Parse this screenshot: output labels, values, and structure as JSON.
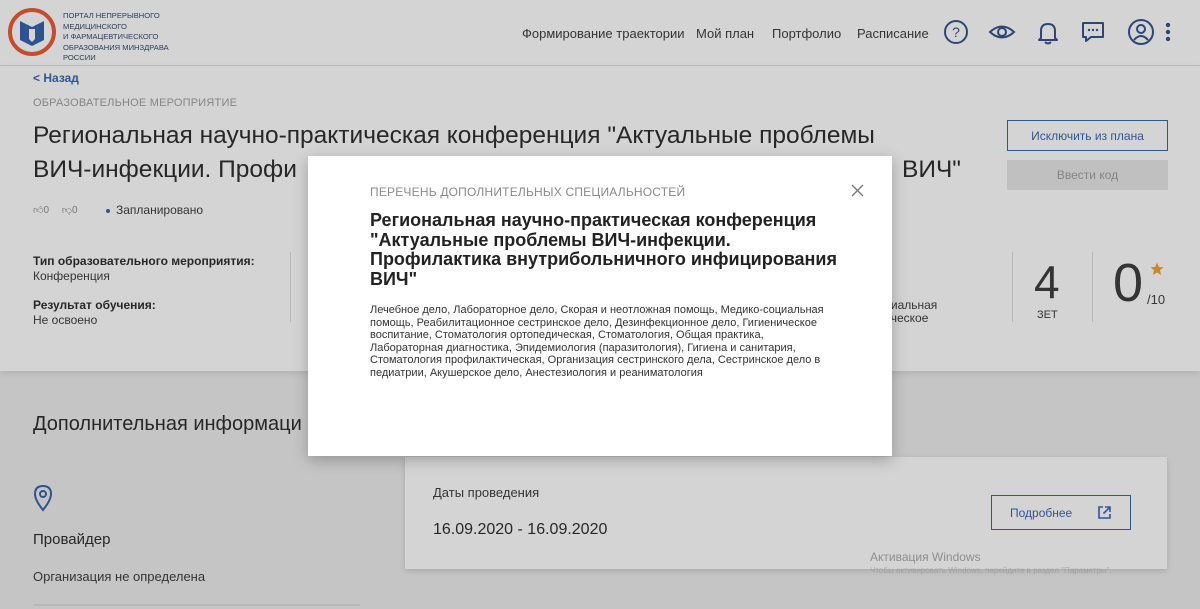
{
  "header": {
    "logo_lines": [
      "Портал непрерывного",
      "медицинского",
      "и фармацевтического",
      "образования минздрава России"
    ],
    "nav": [
      "Формирование траектории",
      "Мой план",
      "Портфолио",
      "Расписание"
    ]
  },
  "page": {
    "back": "< Назад",
    "kind": "Образовательное мероприятие",
    "title_line1": "Региональная научно-практическая конференция \"Актуальные проблемы",
    "title_line2_left": "ВИЧ-инфекции. Профи",
    "title_line2_right": "ВИЧ\"",
    "likes": "0",
    "dislikes": "0",
    "status": "Запланировано"
  },
  "actions": {
    "exclude": "Исключить из плана",
    "enter_code": "Ввести код"
  },
  "info": {
    "type_label": "Тип образовательного мероприятия:",
    "type_value": "Конференция",
    "result_label": "Результат обучения:",
    "result_value": "Не освоено",
    "partial_line1": "циальная",
    "partial_line2": "ическое"
  },
  "stats": {
    "zet": "4",
    "zet_label": "ЗЕТ",
    "score": "0",
    "score_max": "/10",
    "accent_color": "#f0a020"
  },
  "extra": {
    "title": "Дополнительная информаци",
    "provider_label": "Провайдер",
    "provider_value": "Организация не определена",
    "dates_label": "Даты проведения",
    "dates_value": "16.09.2020 - 16.09.2020",
    "more": "Подробнее"
  },
  "watermark": {
    "line1": "Активация Windows",
    "line2": "Чтобы активировать Windows, перейдите в раздел \"Параметры\"."
  },
  "modal": {
    "kind": "Перечень дополнительных специальностей",
    "title": "Региональная научно-практическая конференция \"Актуальные проблемы ВИЧ-инфекции. Профилактика внутрибольничного инфицирования ВИЧ\"",
    "body": "Лечебное дело, Лабораторное дело, Скорая и неотложная помощь, Медико-социальная помощь, Реабилитационное сестринское дело, Дезинфекционное дело, Гигиеническое воспитание, Стоматология ортопедическая, Стоматология, Общая практика, Лабораторная диагностика, Эпидемиология (паразитология), Гигиена и санитария, Стоматология профилактическая, Организация сестринского дела, Сестринское дело в педиатрии, Акушерское дело, Анестезиология и реаниматология"
  }
}
